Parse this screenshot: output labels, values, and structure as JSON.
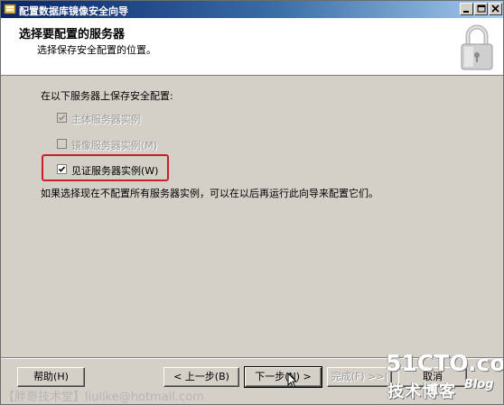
{
  "window": {
    "title": "配置数据库镜像安全向导"
  },
  "header": {
    "title": "选择要配置的服务器",
    "subtitle": "选择保存安全配置的位置。",
    "icon": "lock-icon"
  },
  "body": {
    "prompt": "在以下服务器上保存安全配置:",
    "options": [
      {
        "label": "主体服务器实例",
        "checked": true,
        "enabled": false
      },
      {
        "label": "镜像服务器实例(M)",
        "checked": false,
        "enabled": false
      },
      {
        "label": "见证服务器实例(W)",
        "checked": true,
        "enabled": true
      }
    ],
    "note": "如果选择现在不配置所有服务器实例，可以在以后再运行此向导来配置它们。",
    "highlight_color": "#c8202a"
  },
  "footer": {
    "help": "帮助(H)",
    "back": "< 上一步(B)",
    "next": "下一步(N) >",
    "finish": "完成(F) >>|",
    "cancel": "取消"
  },
  "watermark": {
    "left": "【胖哥技术堂】liulike@hotmail.com",
    "site": "51CTO.com",
    "blog_cn": "技术博客",
    "blog_en": "Blog"
  }
}
